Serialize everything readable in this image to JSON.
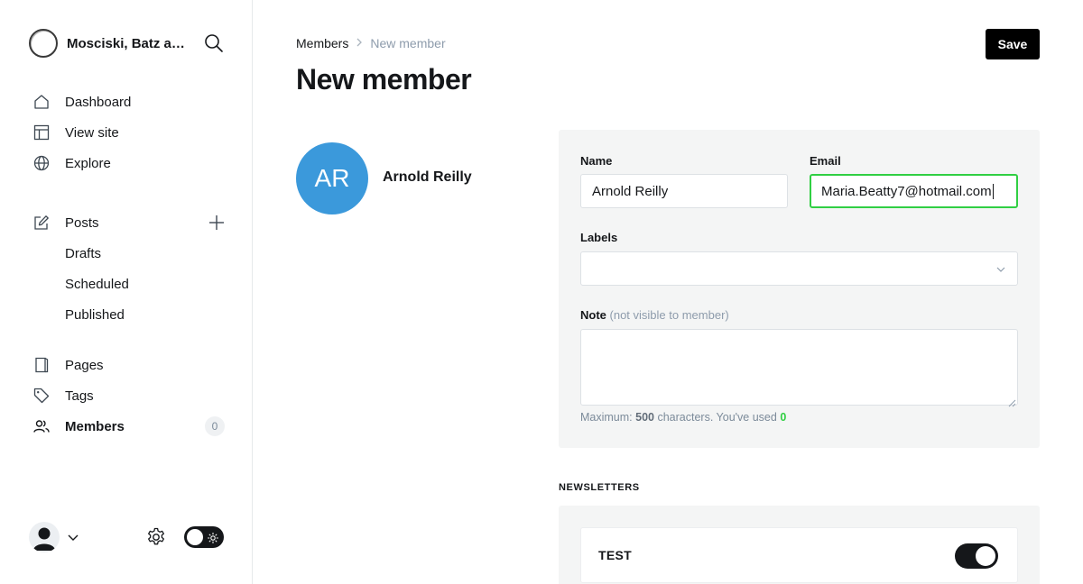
{
  "sidebar": {
    "site_title": "Mosciski, Batz and Spinka",
    "nav": [
      {
        "label": "Dashboard",
        "icon": "home-icon"
      },
      {
        "label": "View site",
        "icon": "layout-icon"
      },
      {
        "label": "Explore",
        "icon": "globe-icon"
      }
    ],
    "posts": {
      "label": "Posts",
      "icon": "edit-icon",
      "sub": [
        "Drafts",
        "Scheduled",
        "Published"
      ]
    },
    "pages_label": "Pages",
    "tags_label": "Tags",
    "members_label": "Members",
    "members_count": "0"
  },
  "header": {
    "breadcrumb_parent": "Members",
    "breadcrumb_current": "New member",
    "title": "New member",
    "save_label": "Save"
  },
  "member": {
    "initials": "AR",
    "name": "Arnold Reilly",
    "avatar_color": "#3b99db"
  },
  "form": {
    "name_label": "Name",
    "name_value": "Arnold Reilly",
    "email_label": "Email",
    "email_value": "Maria.Beatty7@hotmail.com",
    "labels_label": "Labels",
    "labels_value": "",
    "note_label": "Note",
    "note_hint": "(not visible to member)",
    "note_value": "",
    "hint_prefix": "Maximum:",
    "hint_max": "500",
    "hint_middle": "characters. You've used",
    "hint_used": "0"
  },
  "newsletters": {
    "heading": "NEWSLETTERS",
    "items": [
      {
        "name": "TEST",
        "enabled": true
      }
    ]
  },
  "colors": {
    "accent_green": "#30cf43",
    "primary_black": "#15171a"
  }
}
